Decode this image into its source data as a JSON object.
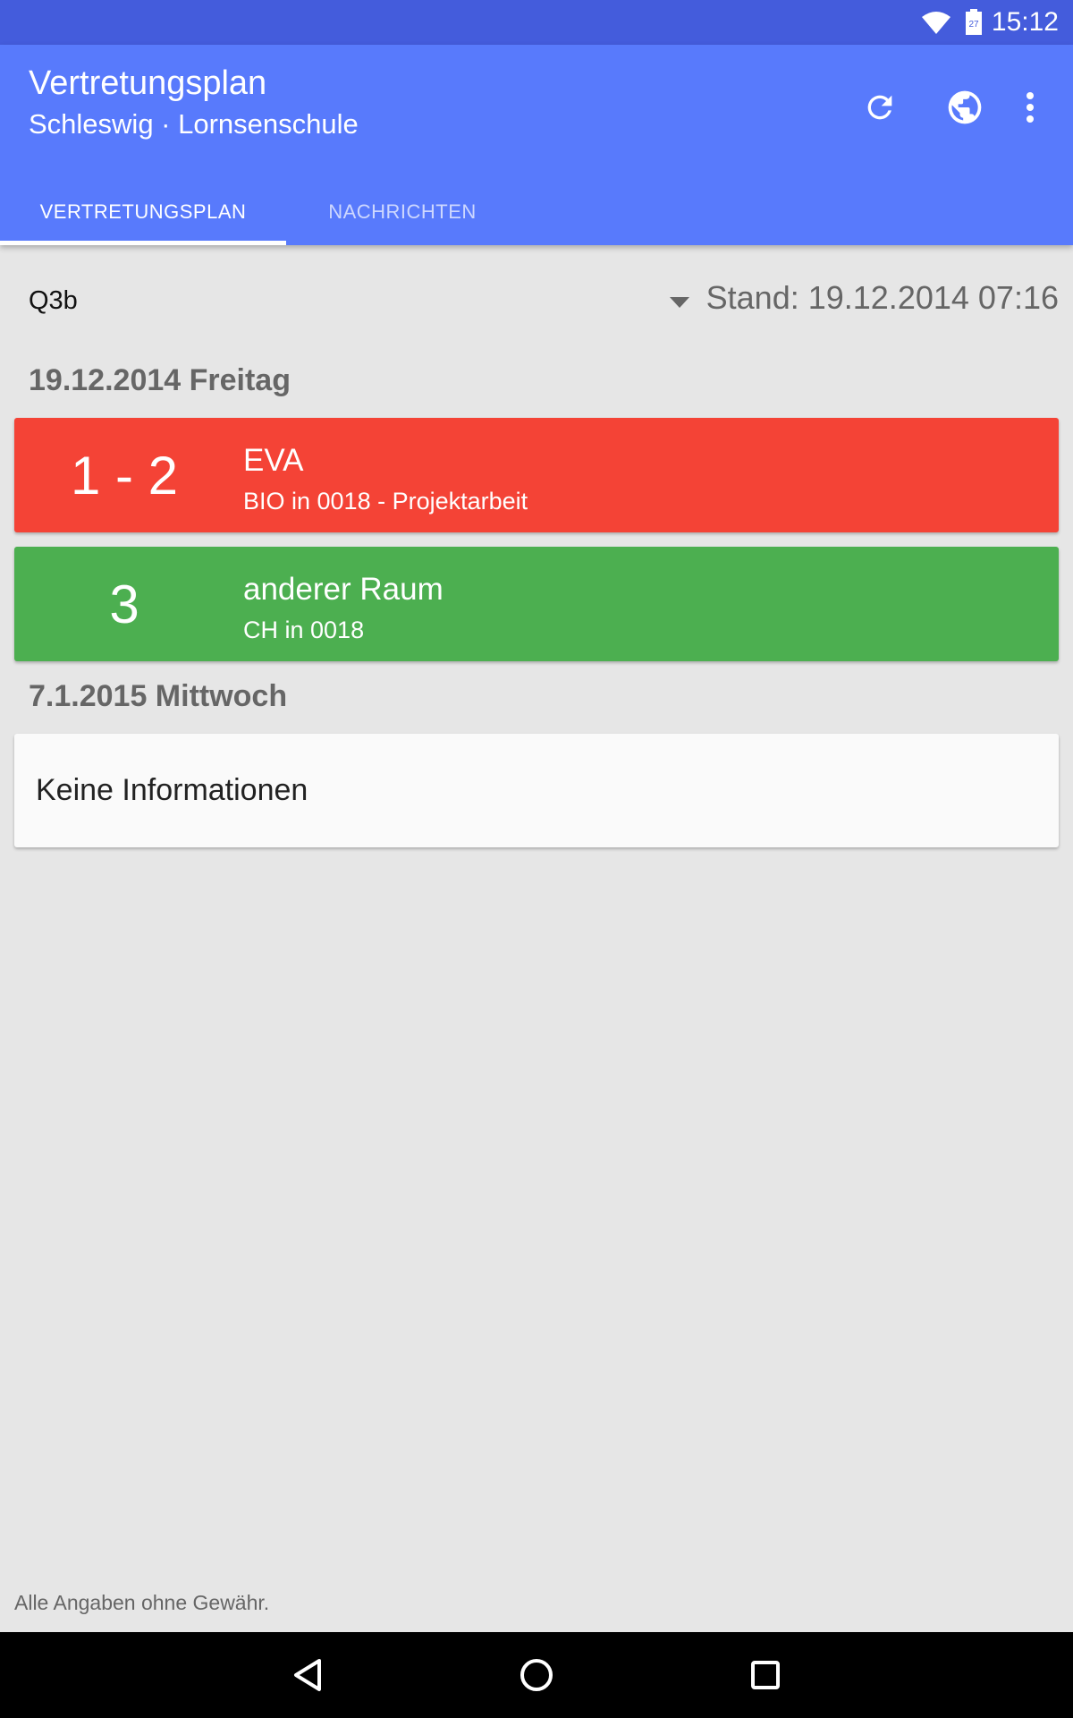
{
  "status_bar": {
    "time": "15:12",
    "battery_level": "27",
    "icons": [
      "wifi-icon",
      "battery-icon"
    ]
  },
  "app_bar": {
    "title": "Vertretungsplan",
    "subtitle": "Schleswig · Lornsenschule",
    "actions": [
      "refresh-icon",
      "globe-icon",
      "more-vert-icon"
    ],
    "tabs": [
      {
        "label": "VERTRETUNGSPLAN",
        "selected": true
      },
      {
        "label": "NACHRICHTEN",
        "selected": false
      }
    ]
  },
  "filter": {
    "class_value": "Q3b",
    "stand": "Stand: 19.12.2014 07:16"
  },
  "days": [
    {
      "header": "19.12.2014 Freitag",
      "entries": [
        {
          "lesson": "1 - 2",
          "type": "EVA",
          "detail": "BIO in 0018 - Projektarbeit",
          "color": "#f44336"
        },
        {
          "lesson": "3",
          "type": "anderer Raum",
          "detail": "CH in 0018",
          "color": "#4caf50"
        }
      ]
    },
    {
      "header": "7.1.2015 Mittwoch",
      "info": "Keine Informationen"
    }
  ],
  "footer": {
    "disclaimer": "Alle Angaben ohne Gewähr."
  },
  "colors": {
    "primary": "#587afc",
    "status_bar": "#445cdc",
    "background": "#e6e6e6"
  }
}
